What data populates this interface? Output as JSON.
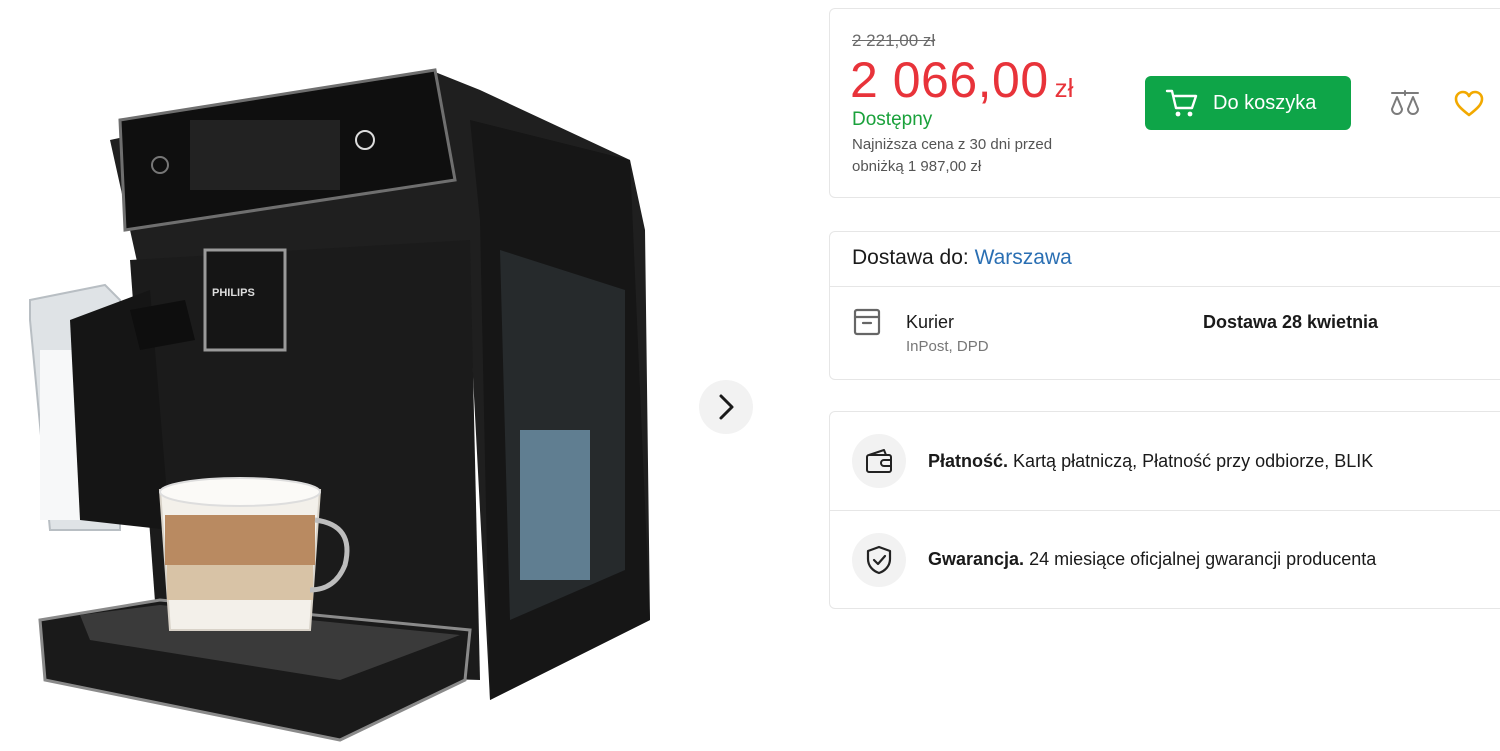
{
  "gallery": {
    "image_alt": "Ekspres do kawy PHILIPS",
    "brand_label": "PHILIPS",
    "next_icon": "chevron-right-icon"
  },
  "price": {
    "old_price": "2 221,00 zł",
    "amount": "2 066,00",
    "currency": "zł",
    "availability": "Dostępny",
    "lowest_price_note": "Najniższa cena z 30 dni przed obniżką 1 987,00 zł",
    "add_to_cart_label": "Do koszyka",
    "cart_icon": "cart-icon",
    "compare_icon": "compare-icon",
    "wishlist_icon": "heart-icon",
    "colors": {
      "price": "#e8333a",
      "availability": "#1aa13b",
      "button": "#0ea548",
      "heart": "#f2a900"
    }
  },
  "delivery": {
    "label": "Dostawa do:",
    "city": "Warszawa",
    "courier_label": "Kurier",
    "courier_providers": "InPost, DPD",
    "date": "Dostawa 28 kwietnia",
    "courier_icon": "box-icon"
  },
  "payment": {
    "title": "Płatność.",
    "text": "Kartą płatniczą, Płatność przy odbiorze, BLIK",
    "icon": "wallet-icon"
  },
  "warranty": {
    "title": "Gwarancja.",
    "text": "24 miesiące oficjalnej gwarancji producenta",
    "icon": "shield-check-icon"
  }
}
